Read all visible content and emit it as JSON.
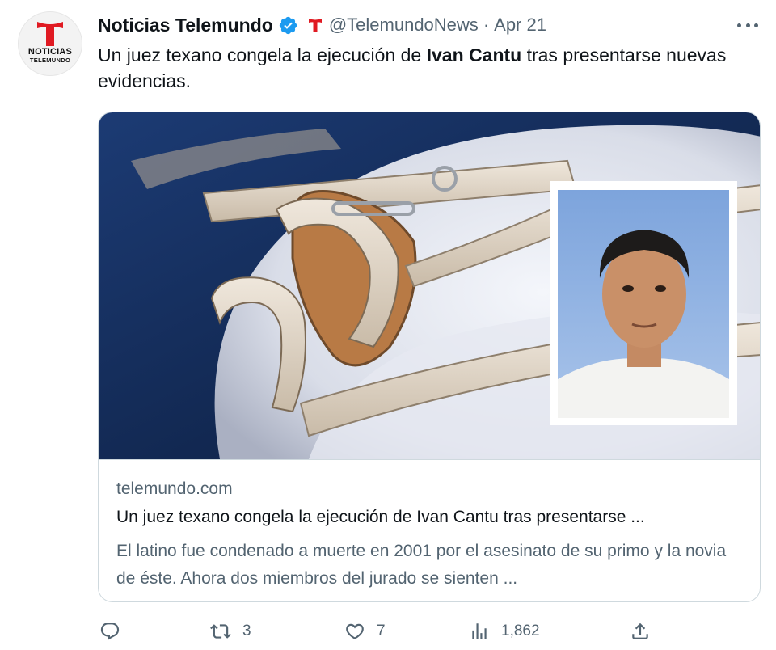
{
  "account": {
    "name": "Noticias Telemundo",
    "handle": "@TelemundoNews",
    "separator": "·",
    "date": "Apr 21",
    "avatar_line1": "NOTICIAS",
    "avatar_line2": "TELEMUNDO"
  },
  "tweet": {
    "text_before": "Un juez texano congela la ejecución de ",
    "text_bold": "Ivan Cantu",
    "text_after": " tras presentarse nuevas evidencias."
  },
  "card": {
    "domain": "telemundo.com",
    "title": "Un juez texano congela la ejecución de Ivan Cantu tras presentarse ...",
    "description": "El latino fue condenado a muerte en 2001 por el asesinato de su primo y la novia de éste. Ahora dos miembros del jurado se sienten ..."
  },
  "actions": {
    "replies": "",
    "retweets": "3",
    "likes": "7",
    "views": "1,862"
  },
  "colors": {
    "brand_red": "#e01a22",
    "verified_blue": "#1d9bf0",
    "secondary_text": "#536471",
    "primary_text": "#0f1419",
    "border": "#cfd9de"
  },
  "icons": [
    "telemundo-logo-icon",
    "verified-badge-icon",
    "affiliate-badge-icon",
    "more-icon",
    "reply-icon",
    "retweet-icon",
    "like-icon",
    "views-icon",
    "share-icon"
  ]
}
